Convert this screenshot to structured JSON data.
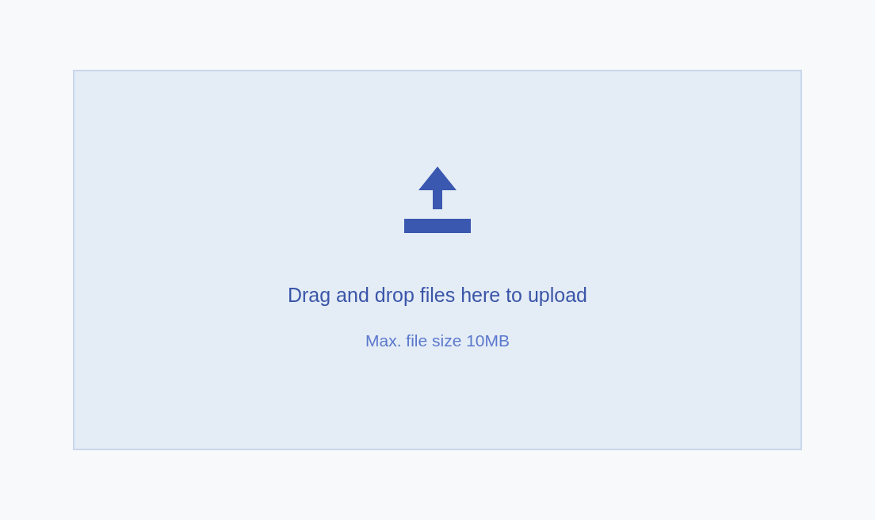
{
  "dropzone": {
    "title": "Drag and drop files here to upload",
    "hint": "Max. file size 10MB"
  }
}
